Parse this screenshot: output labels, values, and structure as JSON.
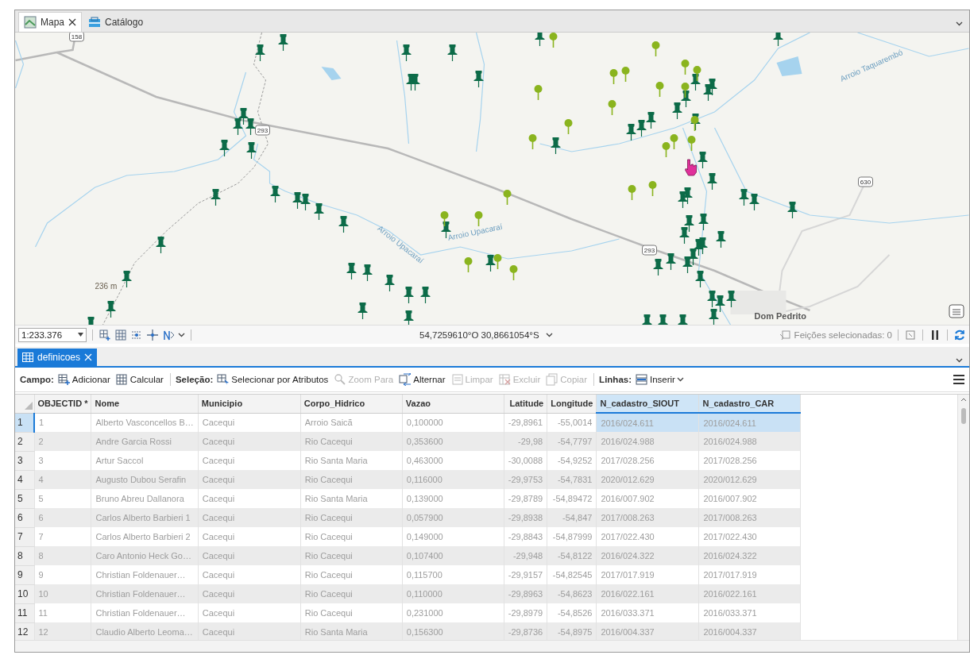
{
  "map_view": {
    "tabs": [
      {
        "label": "Mapa",
        "selected": true,
        "closable": true
      },
      {
        "label": "Catálogo",
        "selected": false,
        "closable": false
      }
    ],
    "labels": [
      {
        "text": "158",
        "kind": "shield"
      },
      {
        "text": "293",
        "kind": "shield"
      },
      {
        "text": "293",
        "kind": "shield"
      },
      {
        "text": "630",
        "kind": "shield"
      },
      {
        "text": "236 m",
        "kind": "elevation"
      },
      {
        "text": "Dom Pedrito",
        "kind": "place"
      },
      {
        "text": "Arroio Upacaraí",
        "kind": "water"
      },
      {
        "text": "Arroio Upacaraí",
        "kind": "water"
      },
      {
        "text": "Arroio Taquarembó",
        "kind": "water"
      }
    ],
    "status_bar": {
      "scale": "1:233.376",
      "coordinates": "54,7259610°O 30,8661054°S",
      "selected_features": "Feições selecionadas: 0"
    }
  },
  "table_view": {
    "tabs": [
      {
        "label": "definicoes",
        "selected": true
      }
    ],
    "toolbar": [
      {
        "kind": "label",
        "text": "Campo:"
      },
      {
        "kind": "button",
        "text": "Adicionar",
        "disabled": false
      },
      {
        "kind": "button",
        "text": "Calcular",
        "disabled": false
      },
      {
        "kind": "separator"
      },
      {
        "kind": "label",
        "text": "Seleção:"
      },
      {
        "kind": "button",
        "text": "Selecionar por Atributos",
        "disabled": false
      },
      {
        "kind": "button",
        "text": "Zoom Para",
        "disabled": true
      },
      {
        "kind": "button",
        "text": "Alternar",
        "disabled": false
      },
      {
        "kind": "button",
        "text": "Limpar",
        "disabled": true
      },
      {
        "kind": "button",
        "text": "Excluir",
        "disabled": true
      },
      {
        "kind": "button",
        "text": "Copiar",
        "disabled": true
      },
      {
        "kind": "separator"
      },
      {
        "kind": "label",
        "text": "Linhas:"
      },
      {
        "kind": "dropdown",
        "text": "Inserir",
        "disabled": false
      }
    ],
    "columns": [
      {
        "name": "OBJECTID *",
        "selected": false
      },
      {
        "name": "Nome",
        "selected": false
      },
      {
        "name": "Municipio",
        "selected": false
      },
      {
        "name": "Corpo_Hidrico",
        "selected": false
      },
      {
        "name": "Vazao",
        "selected": false
      },
      {
        "name": "Latitude",
        "selected": false
      },
      {
        "name": "Longitude",
        "selected": false
      },
      {
        "name": "N_cadastro_SIOUT",
        "selected": true
      },
      {
        "name": "N_cadastro_CAR",
        "selected": true
      }
    ],
    "rows": [
      {
        "number": "1",
        "selected": true,
        "cells": [
          "1",
          "Alberto Vasconcellos B…",
          "Cacequi",
          "Arroio Saicã",
          "0,100000",
          "-29,8961",
          "-55,0014",
          "2016/024.611",
          "2016/024.611"
        ]
      },
      {
        "number": "2",
        "selected": false,
        "cells": [
          "2",
          "Andre Garcia Rossi",
          "Cacequi",
          "Rio Cacequi",
          "0,353600",
          "-29,98",
          "-54,7797",
          "2016/024.988",
          "2016/024.988"
        ]
      },
      {
        "number": "3",
        "selected": false,
        "cells": [
          "3",
          "Artur Saccol",
          "Cacequi",
          "Rio Santa Maria",
          "0,463000",
          "-30,0088",
          "-54,9252",
          "2017/028.256",
          "2017/028.256"
        ]
      },
      {
        "number": "4",
        "selected": false,
        "cells": [
          "4",
          "Augusto Dubou Serafin",
          "Cacequi",
          "Rio Cacequi",
          "0,116000",
          "-29,9753",
          "-54,7831",
          "2020/012.629",
          "2020/012.629"
        ]
      },
      {
        "number": "5",
        "selected": false,
        "cells": [
          "5",
          "Bruno Abreu Dallanora",
          "Cacequi",
          "Rio Santa Maria",
          "0,139000",
          "-29,8789",
          "-54,89472",
          "2016/007.902",
          "2016/007.902"
        ]
      },
      {
        "number": "6",
        "selected": false,
        "cells": [
          "6",
          "Carlos Alberto Barbieri 1",
          "Cacequi",
          "Rio Cacequi",
          "0,057900",
          "-29,8938",
          "-54,847",
          "2017/008.263",
          "2017/008.263"
        ]
      },
      {
        "number": "7",
        "selected": false,
        "cells": [
          "7",
          "Carlos Alberto Barbieri 2",
          "Cacequi",
          "Rio Cacequi",
          "0,149000",
          "-29,8843",
          "-54,87999",
          "2017/022.430",
          "2017/022.430"
        ]
      },
      {
        "number": "8",
        "selected": false,
        "cells": [
          "8",
          "Caro Antonio Heck Go…",
          "Cacequi",
          "Rio Cacequi",
          "0,107400",
          "-29,948",
          "-54,8122",
          "2016/024.322",
          "2016/024.322"
        ]
      },
      {
        "number": "9",
        "selected": false,
        "cells": [
          "9",
          "Christian Foldenauer…",
          "Cacequi",
          "Rio Cacequi",
          "0,115700",
          "-29,9157",
          "-54,82545",
          "2017/017.919",
          "2017/017.919"
        ]
      },
      {
        "number": "10",
        "selected": false,
        "cells": [
          "10",
          "Christian Foldenauer…",
          "Cacequi",
          "Rio Cacequi",
          "0,110000",
          "-29,8963",
          "-54,8623",
          "2016/022.161",
          "2016/022.161"
        ]
      },
      {
        "number": "11",
        "selected": false,
        "cells": [
          "11",
          "Christian Foldenauer…",
          "Cacequi",
          "Rio Cacequi",
          "0,231000",
          "-29,8979",
          "-54,8526",
          "2016/033.371",
          "2016/033.371"
        ]
      },
      {
        "number": "12",
        "selected": false,
        "cells": [
          "12",
          "Claudio Alberto Leoma…",
          "Cacequi",
          "Rio Santa Maria",
          "0,156300",
          "-29,8736",
          "-54,8975",
          "2016/004.337",
          "2016/004.337"
        ]
      }
    ]
  }
}
